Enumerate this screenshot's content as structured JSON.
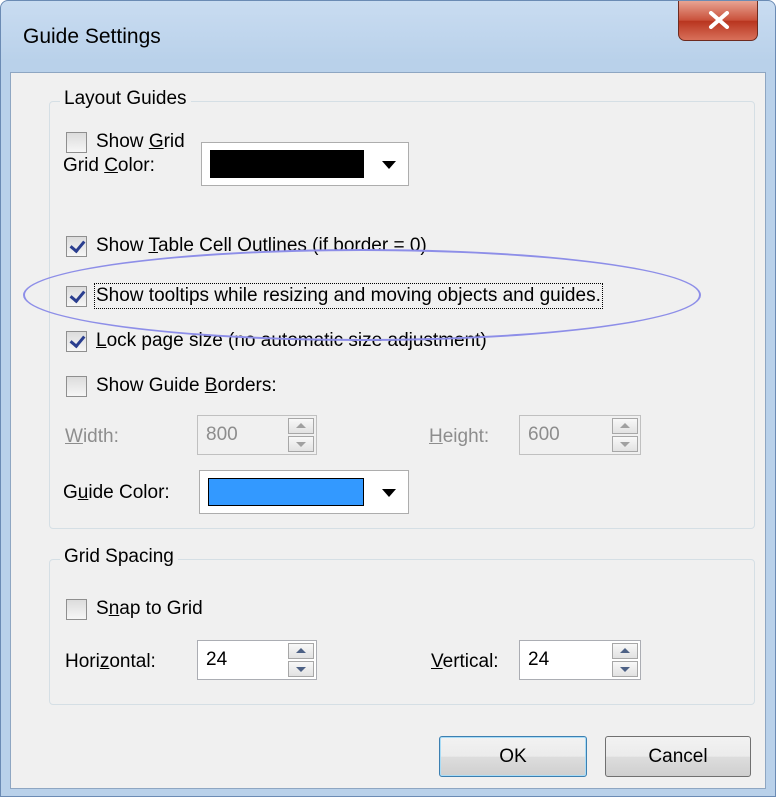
{
  "window": {
    "title": "Guide Settings"
  },
  "layout_guides": {
    "group_title": "Layout Guides",
    "show_grid": {
      "before": "Show ",
      "mnemonic": "G",
      "after": "rid",
      "checked": false
    },
    "grid_color": {
      "before": "Grid ",
      "mnemonic": "C",
      "after": "olor:",
      "color": "#000000"
    },
    "show_table_outlines": {
      "before": "Show ",
      "mnemonic": "T",
      "after": "able Cell Outlines (if border = 0)",
      "checked": true
    },
    "show_tooltips": {
      "label": "Show tooltips while resizing and moving objects and guides.",
      "checked": true
    },
    "lock_page_size": {
      "mnemonic": "L",
      "after": "ock page size (no automatic size adjustment)",
      "checked": true
    },
    "show_guide_borders": {
      "before": "Show Guide ",
      "mnemonic": "B",
      "after": "orders:",
      "checked": false
    },
    "width": {
      "mnemonic": "W",
      "after": "idth:",
      "value": "800"
    },
    "height": {
      "mnemonic": "H",
      "after": "eight:",
      "value": "600"
    },
    "guide_color": {
      "before": "G",
      "mnemonic": "u",
      "after": "ide Color:",
      "color": "#3399ff"
    }
  },
  "grid_spacing": {
    "group_title": "Grid Spacing",
    "snap_to_grid": {
      "before": "S",
      "mnemonic": "n",
      "after": "ap to Grid",
      "checked": false
    },
    "horizontal": {
      "before": "Hori",
      "mnemonic": "z",
      "after": "ontal:",
      "value": "24"
    },
    "vertical": {
      "mnemonic": "V",
      "after": "ertical:",
      "value": "24"
    }
  },
  "buttons": {
    "ok": "OK",
    "cancel": "Cancel"
  }
}
